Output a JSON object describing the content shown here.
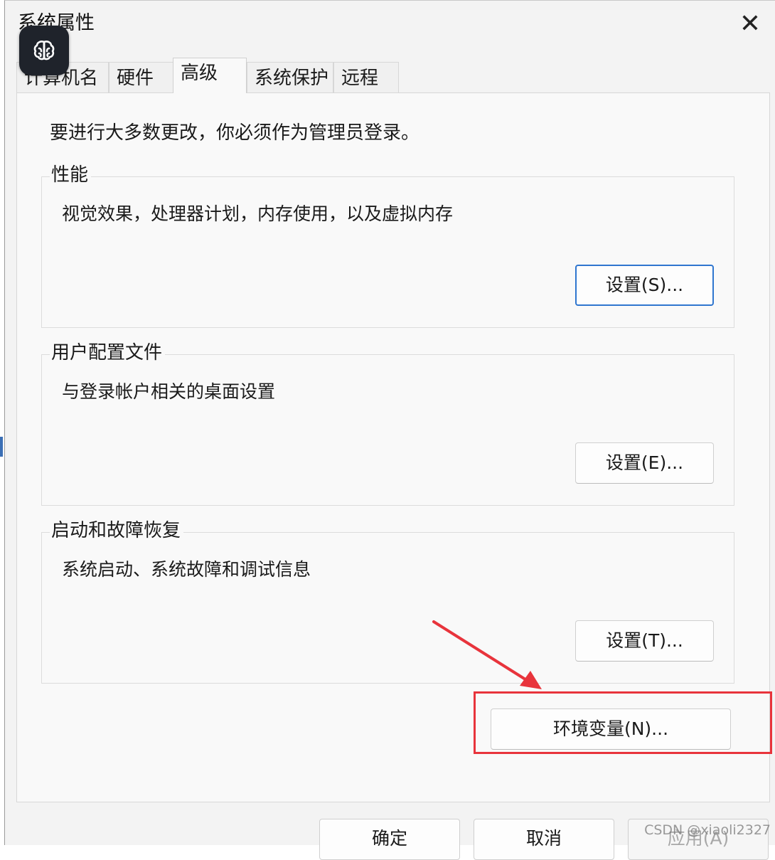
{
  "window": {
    "title": "系统属性",
    "close_glyph": "✕"
  },
  "tabs": [
    {
      "label": "计算机名",
      "active": false
    },
    {
      "label": "硬件",
      "active": false
    },
    {
      "label": "高级",
      "active": true
    },
    {
      "label": "系统保护",
      "active": false
    },
    {
      "label": "远程",
      "active": false
    }
  ],
  "advanced": {
    "admin_notice": "要进行大多数更改，你必须作为管理员登录。",
    "performance": {
      "title": "性能",
      "description": "视觉效果，处理器计划，内存使用，以及虚拟内存",
      "button": "设置(S)..."
    },
    "user_profiles": {
      "title": "用户配置文件",
      "description": "与登录帐户相关的桌面设置",
      "button": "设置(E)..."
    },
    "startup_recovery": {
      "title": "启动和故障恢复",
      "description": "系统启动、系统故障和调试信息",
      "button": "设置(T)..."
    },
    "env_button": "环境变量(N)..."
  },
  "footer": {
    "ok": "确定",
    "cancel": "取消",
    "apply": "应用(A)"
  },
  "watermark": "CSDN @xiaoli2327",
  "icons": {
    "app_badge": "brain-icon",
    "close": "close-icon",
    "annotation": "red-arrow"
  },
  "colors": {
    "highlight": "#e8343c",
    "primary_border": "#2f76cf",
    "badge_bg": "#1f232b"
  }
}
